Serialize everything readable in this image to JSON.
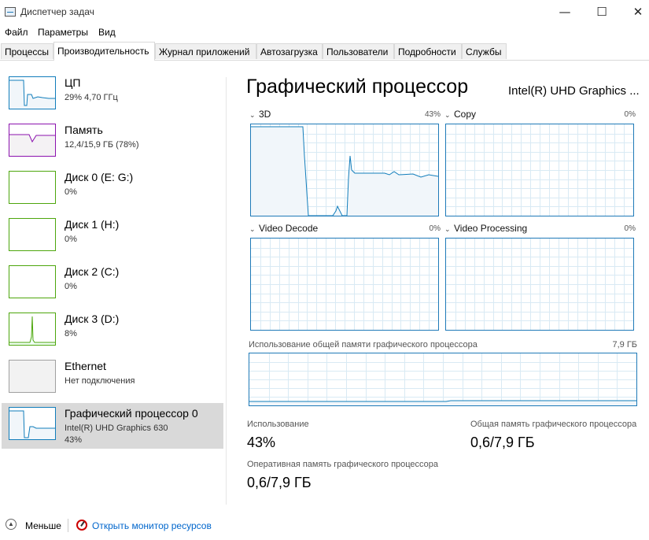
{
  "window": {
    "title": "Диспетчер задач",
    "minimize": "—",
    "maximize": "☐",
    "close": "✕"
  },
  "menu": [
    "Файл",
    "Параметры",
    "Вид"
  ],
  "tabs": [
    "Процессы",
    "Производительность",
    "Журнал приложений",
    "Автозагрузка",
    "Пользователи",
    "Подробности",
    "Службы"
  ],
  "active_tab": "Производительность",
  "sidebar": {
    "items": [
      {
        "name": "ЦП",
        "sub1": "29%  4,70 ГГц",
        "sub2": "",
        "color": "#117dbb",
        "fill": "#f1f6fa"
      },
      {
        "name": "Память",
        "sub1": "12,4/15,9 ГБ (78%)",
        "sub2": "",
        "color": "#8b12ae",
        "fill": "#f4f2f4"
      },
      {
        "name": "Диск 0 (E: G:)",
        "sub1": "0%",
        "sub2": "",
        "color": "#4da60c",
        "fill": "#effff4"
      },
      {
        "name": "Диск 1 (H:)",
        "sub1": "0%",
        "sub2": "",
        "color": "#4da60c",
        "fill": "#effff4"
      },
      {
        "name": "Диск 2 (C:)",
        "sub1": "0%",
        "sub2": "",
        "color": "#4da60c",
        "fill": "#effff4"
      },
      {
        "name": "Диск 3 (D:)",
        "sub1": "8%",
        "sub2": "",
        "color": "#4da60c",
        "fill": "#effff4"
      },
      {
        "name": "Ethernet",
        "sub1": "Нет подключения",
        "sub2": "",
        "color": "#a0a0a0",
        "fill": "#f2f2f2"
      },
      {
        "name": "Графический процессор 0",
        "sub1": "Intel(R) UHD Graphics 630",
        "sub2": "43%",
        "color": "#117dbb",
        "fill": "#f1f6fa"
      }
    ],
    "selected": "Графический процессор 0"
  },
  "main": {
    "title": "Графический процессор",
    "model": "Intel(R) UHD Graphics ...",
    "engines": [
      {
        "name": "3D",
        "percent": "43%"
      },
      {
        "name": "Copy",
        "percent": "0%"
      },
      {
        "name": "Video Decode",
        "percent": "0%"
      },
      {
        "name": "Video Processing",
        "percent": "0%"
      }
    ],
    "shared_memory": {
      "label": "Использование общей памяти графического процессора",
      "max": "7,9 ГБ"
    },
    "stats": {
      "usage_label": "Использование",
      "usage_value": "43%",
      "shared_label": "Общая память графического процессора",
      "shared_value": "0,6/7,9 ГБ",
      "dedicated_label": "Оперативная память графического процессора",
      "dedicated_value": "0,6/7,9 ГБ"
    }
  },
  "footer": {
    "less": "Меньше",
    "monitor": "Открыть монитор ресурсов"
  },
  "colors": {
    "accent": "#117dbb",
    "grid": "#d9eaf4",
    "graph_fill": "#f1f6fa",
    "link": "#0066cc"
  }
}
